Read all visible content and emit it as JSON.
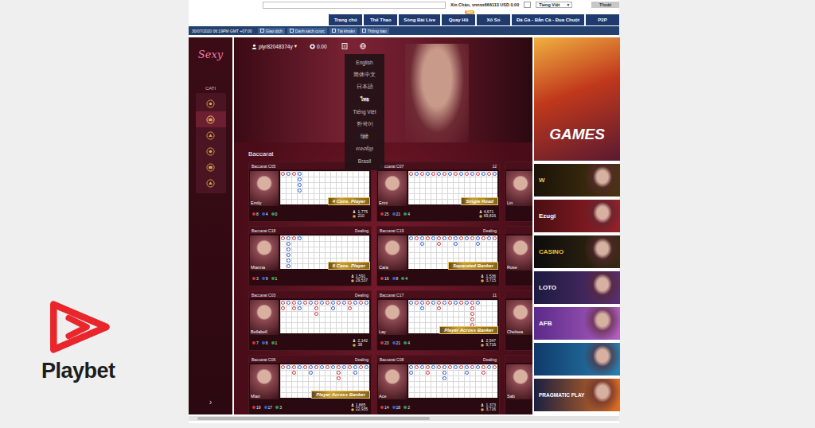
{
  "top_bar": {
    "greeting": "Xin Chào, vnnxx666113 USD 0.00",
    "language": "Tiếng Việt",
    "language_caret": "▾",
    "logout": "Thoát"
  },
  "nav_tabs": [
    {
      "label": "Trang chủ",
      "selected": false
    },
    {
      "label": "Thể Thao",
      "selected": false
    },
    {
      "label": "Sòng Bài Live",
      "selected": false
    },
    {
      "label": "Quay Hũ",
      "selected": false,
      "badge": "Hot"
    },
    {
      "label": "Xổ Số",
      "selected": false
    },
    {
      "label": "Đá Gà - Bắn Cá - Đua Chuột",
      "selected": false
    },
    {
      "label": "P2P",
      "selected": false
    }
  ],
  "sub_bar": {
    "datetime": "30/07/2020 06:19PM GMT +07:00",
    "links": [
      "Giao dịch",
      "Danh sách cược",
      "Tài khoản",
      "Thông báo"
    ]
  },
  "game": {
    "logo": "Sexy",
    "category_label": "CATI",
    "categories": [
      {
        "selected": false
      },
      {
        "selected": true
      },
      {
        "selected": false
      },
      {
        "selected": false
      },
      {
        "selected": false
      },
      {
        "selected": false
      }
    ],
    "expand": "›",
    "user": "plyr82048374y",
    "user_caret": "▾",
    "balance": "0.00",
    "languages": [
      {
        "label": "English",
        "selected": false
      },
      {
        "label": "简体中文",
        "selected": false
      },
      {
        "label": "日本語",
        "selected": false
      },
      {
        "label": "ไทย",
        "selected": true
      },
      {
        "label": "Tiếng Việt",
        "selected": false
      },
      {
        "label": "한국어",
        "selected": false
      },
      {
        "label": "हिंदी",
        "selected": false
      },
      {
        "label": "ភាសាខ្មែរ",
        "selected": false
      },
      {
        "label": "Brasil",
        "selected": false
      }
    ],
    "section_title": "Baccarat",
    "tables": [
      {
        "kind": "full",
        "title": "Baccarat C05",
        "dealer": "Emily",
        "badge": "4 Cons. Player",
        "counts": [
          {
            "value": "8",
            "color": "#d6333b"
          },
          {
            "value": "4",
            "color": "#2b5fd8"
          },
          {
            "value": "0",
            "color": "#2e9e4f"
          }
        ],
        "players": "1,775",
        "bets": "210",
        "road": [
          "b",
          "p",
          "b",
          "pppp"
        ]
      },
      {
        "kind": "full",
        "title": "Baccarat C07",
        "status": "12",
        "dealer": "Erini",
        "badge": "Single Road",
        "counts": [
          {
            "value": "25",
            "color": "#d6333b"
          },
          {
            "value": "21",
            "color": "#2b5fd8"
          },
          {
            "value": "4",
            "color": "#2e9e4f"
          }
        ],
        "players": "4,671",
        "bets": "69,816",
        "road": [
          "b",
          "p",
          "b",
          "p",
          "b",
          "p",
          "b",
          "p",
          "b",
          "p",
          "b",
          "p",
          "b",
          "p",
          "b",
          "p"
        ]
      },
      {
        "kind": "partial",
        "dealer": "Lin"
      },
      {
        "kind": "full",
        "title": "Baccarat C18",
        "status": "Dealing",
        "dealer": "Mianna",
        "badge": "6 Cons. Player",
        "counts": [
          {
            "value": "3",
            "color": "#d6333b"
          },
          {
            "value": "9",
            "color": "#2b5fd8"
          },
          {
            "value": "1",
            "color": "#2e9e4f"
          }
        ],
        "players": "1,591",
        "bets": "29,537",
        "road": [
          "b",
          "pppppp",
          "b",
          "p"
        ]
      },
      {
        "kind": "full",
        "title": "Baccarat C19",
        "status": "Dealing",
        "dealer": "Cara",
        "badge": "Separated Banker",
        "counts": [
          {
            "value": "16",
            "color": "#d6333b"
          },
          {
            "value": "8",
            "color": "#2b5fd8"
          },
          {
            "value": "4",
            "color": "#2e9e4f"
          }
        ],
        "players": "1,536",
        "bets": "3,715",
        "road": [
          "p",
          "b",
          "pp",
          "b",
          "p",
          "bb",
          "p",
          "b",
          "pp",
          "b",
          "p",
          "b",
          "pp",
          "b",
          "p",
          "b"
        ]
      },
      {
        "kind": "partial",
        "dealer": "Rose"
      },
      {
        "kind": "full",
        "title": "Baccarat C03",
        "status": "Dealing",
        "dealer": "Bellabell",
        "counts": [
          {
            "value": "7",
            "color": "#d6333b"
          },
          {
            "value": "6",
            "color": "#2b5fd8"
          },
          {
            "value": "1",
            "color": "#2e9e4f"
          }
        ],
        "players": "2,142",
        "bets": "38",
        "road": [
          "bb",
          "p",
          "bb",
          "pp",
          "b",
          "p",
          "bbb",
          "p",
          "b",
          "pp",
          "b",
          "p",
          "bb",
          "p",
          "b",
          "p"
        ]
      },
      {
        "kind": "full",
        "title": "Baccarat C17",
        "status": "11",
        "dealer": "Lay",
        "badge": "Player Across Banker",
        "counts": [
          {
            "value": "23",
            "color": "#d6333b"
          },
          {
            "value": "21",
            "color": "#2b5fd8"
          },
          {
            "value": "4",
            "color": "#2e9e4f"
          }
        ],
        "players": "2,547",
        "bets": "9,716",
        "road": [
          "p",
          "b",
          "pp",
          "b",
          "p",
          "bb",
          "p",
          "b",
          "p",
          "b",
          "p",
          "bbbbb",
          "p"
        ]
      },
      {
        "kind": "partial",
        "dealer": "Chelsea"
      },
      {
        "kind": "full",
        "title": "Baccarat C06",
        "status": "Dealing",
        "dealer": "Mian",
        "badge": "Player Across Banker",
        "counts": [
          {
            "value": "19",
            "color": "#d6333b"
          },
          {
            "value": "17",
            "color": "#2b5fd8"
          },
          {
            "value": "3",
            "color": "#2e9e4f"
          }
        ],
        "players": "1,865",
        "bets": "22,935",
        "road": [
          "b",
          "p",
          "bb",
          "p",
          "b",
          "pp",
          "b",
          "p",
          "b",
          "p",
          "bbb",
          "p",
          "b",
          "pp",
          "b",
          "p"
        ]
      },
      {
        "kind": "full",
        "title": "Baccarat C08",
        "status": "Dealing",
        "dealer": "Ace",
        "counts": [
          {
            "value": "14",
            "color": "#d6333b"
          },
          {
            "value": "18",
            "color": "#2b5fd8"
          },
          {
            "value": "2",
            "color": "#2e9e4f"
          }
        ],
        "players": "1,373",
        "bets": "3,716",
        "road": [
          "pp",
          "b",
          "p",
          "bb",
          "p",
          "b",
          "ppp",
          "b",
          "p",
          "b",
          "pp",
          "b",
          "p",
          "bb",
          "p",
          "b"
        ]
      },
      {
        "kind": "partial",
        "dealer": "Sab"
      }
    ]
  },
  "promos": [
    {
      "label": "GAMES"
    },
    {
      "label": "W"
    },
    {
      "label": "Ezugi"
    },
    {
      "label": "CASINO"
    },
    {
      "label": "LOTO"
    },
    {
      "label": "AFB"
    },
    {},
    {
      "label": "PRAGMATIC PLAY"
    }
  ],
  "brand": {
    "name": "Playbet"
  }
}
